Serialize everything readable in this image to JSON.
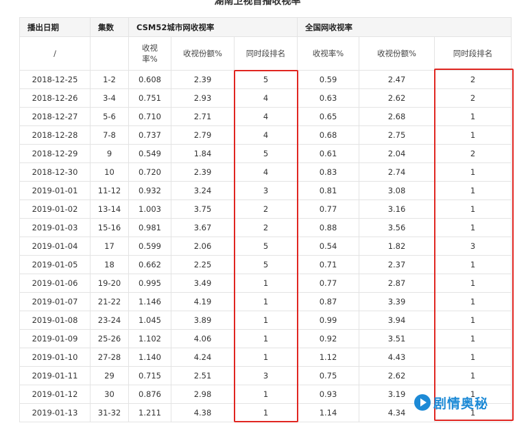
{
  "title": "湖南卫视首播收视率",
  "header": {
    "date": "播出日期",
    "episodes": "集数",
    "csm": "CSM52城市网收视率",
    "national": "全国网收视率"
  },
  "subheader": {
    "slash": "/",
    "rating": "收视率%",
    "share": "收视份额%",
    "rank": "同时段排名",
    "n_rating": "收视率%",
    "n_share": "收视份额%",
    "n_rank": "同时段排名"
  },
  "rows": [
    [
      "2018-12-25",
      "1-2",
      "0.608",
      "2.39",
      "5",
      "0.59",
      "2.47",
      "2"
    ],
    [
      "2018-12-26",
      "3-4",
      "0.751",
      "2.93",
      "4",
      "0.63",
      "2.62",
      "2"
    ],
    [
      "2018-12-27",
      "5-6",
      "0.710",
      "2.71",
      "4",
      "0.65",
      "2.68",
      "1"
    ],
    [
      "2018-12-28",
      "7-8",
      "0.737",
      "2.79",
      "4",
      "0.68",
      "2.75",
      "1"
    ],
    [
      "2018-12-29",
      "9",
      "0.549",
      "1.84",
      "5",
      "0.61",
      "2.04",
      "2"
    ],
    [
      "2018-12-30",
      "10",
      "0.720",
      "2.39",
      "4",
      "0.83",
      "2.74",
      "1"
    ],
    [
      "2019-01-01",
      "11-12",
      "0.932",
      "3.24",
      "3",
      "0.81",
      "3.08",
      "1"
    ],
    [
      "2019-01-02",
      "13-14",
      "1.003",
      "3.75",
      "2",
      "0.77",
      "3.16",
      "1"
    ],
    [
      "2019-01-03",
      "15-16",
      "0.981",
      "3.67",
      "2",
      "0.88",
      "3.56",
      "1"
    ],
    [
      "2019-01-04",
      "17",
      "0.599",
      "2.06",
      "5",
      "0.54",
      "1.82",
      "3"
    ],
    [
      "2019-01-05",
      "18",
      "0.662",
      "2.25",
      "5",
      "0.71",
      "2.37",
      "1"
    ],
    [
      "2019-01-06",
      "19-20",
      "0.995",
      "3.49",
      "1",
      "0.77",
      "2.87",
      "1"
    ],
    [
      "2019-01-07",
      "21-22",
      "1.146",
      "4.19",
      "1",
      "0.87",
      "3.39",
      "1"
    ],
    [
      "2019-01-08",
      "23-24",
      "1.045",
      "3.89",
      "1",
      "0.99",
      "3.94",
      "1"
    ],
    [
      "2019-01-09",
      "25-26",
      "1.102",
      "4.06",
      "1",
      "0.92",
      "3.51",
      "1"
    ],
    [
      "2019-01-10",
      "27-28",
      "1.140",
      "4.24",
      "1",
      "1.12",
      "4.43",
      "1"
    ],
    [
      "2019-01-11",
      "29",
      "0.715",
      "2.51",
      "3",
      "0.75",
      "2.62",
      "1"
    ],
    [
      "2019-01-12",
      "30",
      "0.876",
      "2.98",
      "1",
      "0.93",
      "3.19",
      "1"
    ],
    [
      "2019-01-13",
      "31-32",
      "1.211",
      "4.38",
      "1",
      "1.14",
      "4.34",
      "1"
    ]
  ],
  "watermark": "剧情奥秘",
  "colors": {
    "highlight": "#e0241f",
    "watermark": "#1d8ad6",
    "header_bg": "#f5f5f5"
  }
}
